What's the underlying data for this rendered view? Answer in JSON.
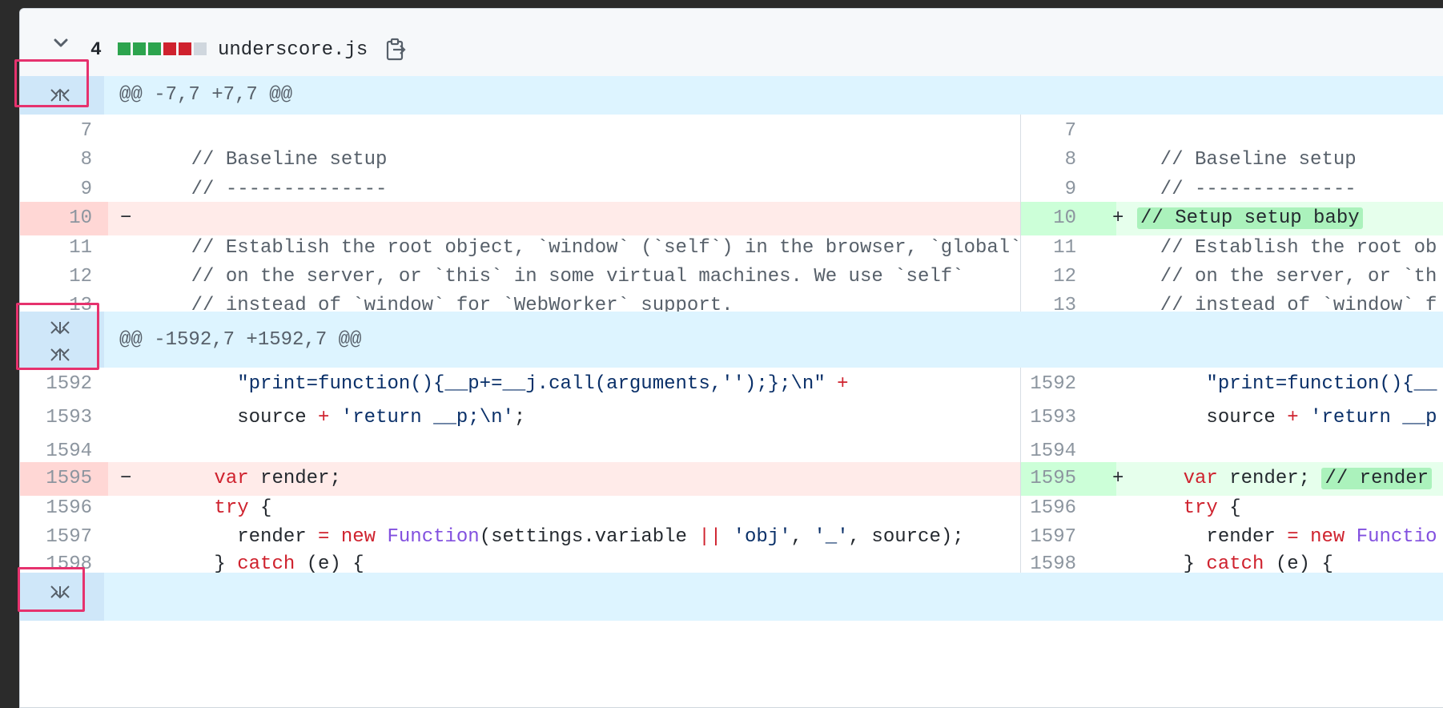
{
  "file": {
    "change_count": "4",
    "filename": "underscore.js",
    "diffstat": [
      "#2da44e",
      "#2da44e",
      "#2da44e",
      "#cf222e",
      "#cf222e",
      "#d0d7de"
    ]
  },
  "hunks": [
    {
      "header": "@@ -7,7 +7,7 @@"
    },
    {
      "header": "@@ -1592,7 +1592,7 @@"
    }
  ],
  "rows1": [
    {
      "ln": "7",
      "left": "",
      "rn": "7",
      "right": "",
      "type": "ctx"
    },
    {
      "ln": "8",
      "left": "    // Baseline setup",
      "rn": "8",
      "right": "  // Baseline setup",
      "type": "ctx"
    },
    {
      "ln": "9",
      "left": "    // --------------",
      "rn": "9",
      "right": "  // --------------",
      "type": "ctx"
    },
    {
      "ln": "10",
      "left": "",
      "rn": "10",
      "right": "// Setup setup baby",
      "type": "chg"
    },
    {
      "ln": "11",
      "left": "    // Establish the root object, `window` (`self`) in the browser, `global`",
      "rn": "11",
      "right": "  // Establish the root ob",
      "type": "ctx"
    },
    {
      "ln": "12",
      "left": "    // on the server, or `this` in some virtual machines. We use `self`",
      "rn": "12",
      "right": "  // on the server, or `th",
      "type": "ctx"
    },
    {
      "ln": "13",
      "left": "    // instead of `window` for `WebWorker` support.",
      "rn": "13",
      "right": "  // instead of `window` f",
      "type": "ctx"
    }
  ],
  "rows2": [
    {
      "ln": "1592",
      "rn": "1592"
    },
    {
      "ln": "1593",
      "rn": "1593"
    },
    {
      "ln": "1594",
      "rn": "1594"
    },
    {
      "ln": "1595",
      "rn": "1595"
    },
    {
      "ln": "1596",
      "rn": "1596"
    },
    {
      "ln": "1597",
      "rn": "1597"
    },
    {
      "ln": "1598",
      "rn": "1598"
    }
  ],
  "markers": {
    "minus": "−",
    "plus": "+"
  },
  "code2": {
    "l1a": "\"print=function(){__p+=__j.call(arguments,'');};\\n\"",
    "l1b": "+",
    "r1": "\"print=function(){__",
    "l2a": "source",
    "l2b": "+",
    "l2c": "'return __p;\\n'",
    "l2d": ";",
    "r2a": "source",
    "r2b": "+",
    "r2c": "'return __p",
    "var": "var",
    "render_semi": " render;",
    "render_comment": "// render",
    "try": "try",
    "brace_open": " {",
    "render_eq": "render",
    "eq": "=",
    "new": "new",
    "Function": "Function",
    "args_a": "(settings.variable",
    "or": "||",
    "obj": "'obj'",
    "comma1": ", ",
    "underscore": "'_'",
    "args_b": ", source);",
    "r_func": "Functio",
    "close_brace": "} ",
    "catch": "catch",
    "catch_args": " (e) {"
  }
}
